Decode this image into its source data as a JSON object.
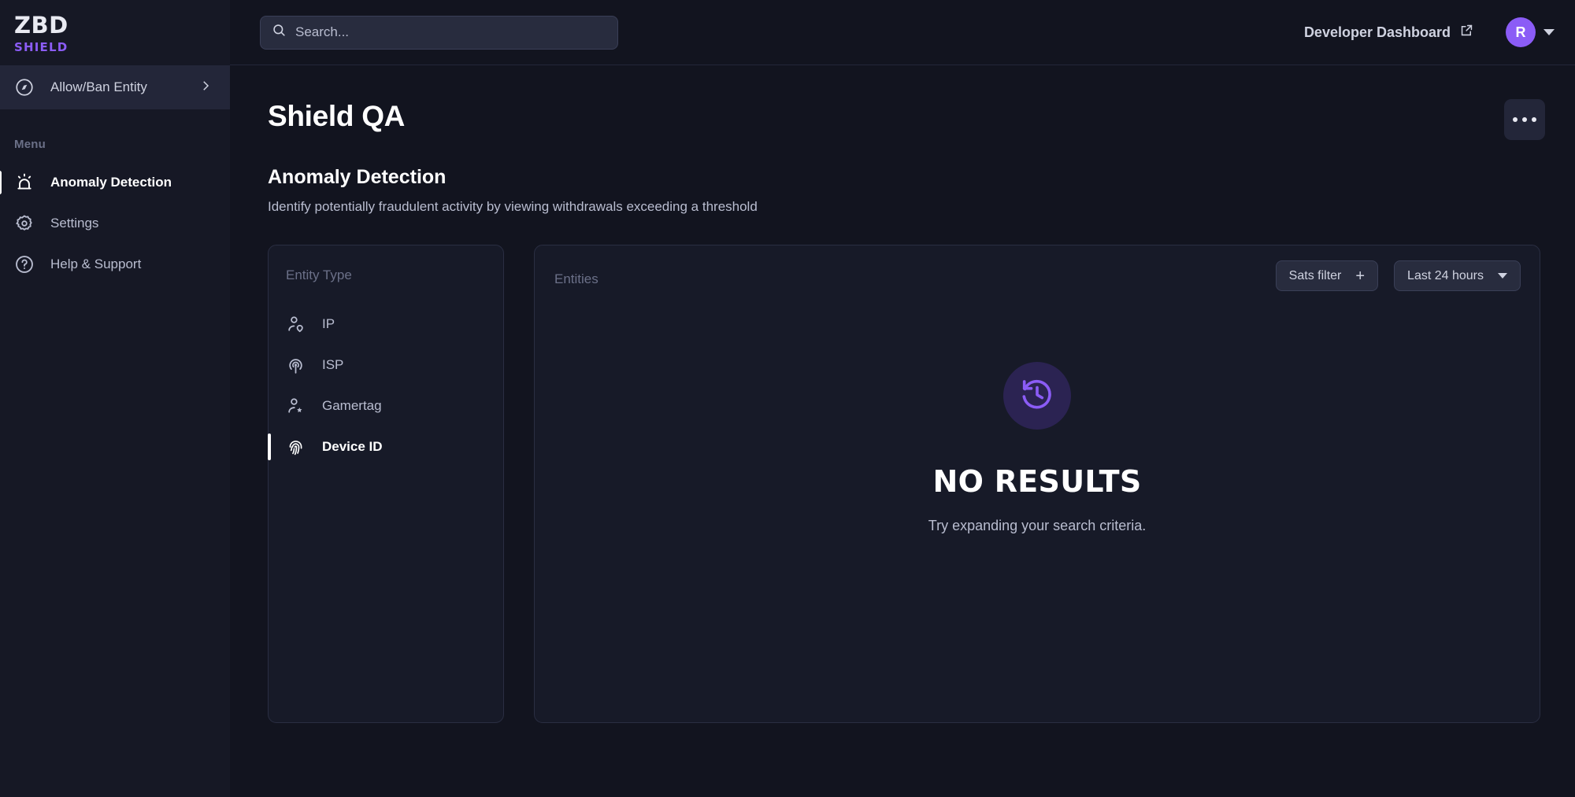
{
  "brand": {
    "line1": "ZBD",
    "line2": "SHIELD",
    "accent": "#8b5cf6"
  },
  "sidebar": {
    "allow_ban": {
      "label": "Allow/Ban Entity",
      "icon": "compass-icon",
      "chevron": "chevron-right-icon"
    },
    "menu_label": "Menu",
    "items": [
      {
        "label": "Anomaly Detection",
        "icon": "alarm-light-icon",
        "active": true
      },
      {
        "label": "Settings",
        "icon": "gear-icon",
        "active": false
      },
      {
        "label": "Help & Support",
        "icon": "question-circle-icon",
        "active": false
      }
    ]
  },
  "topbar": {
    "search": {
      "placeholder": "Search...",
      "value": "",
      "icon": "search-icon"
    },
    "developer_dashboard": {
      "label": "Developer Dashboard",
      "icon": "external-link-icon"
    },
    "avatar": {
      "initial": "R",
      "color": "#8b5cf6"
    },
    "caret": "chevron-down-icon"
  },
  "page": {
    "title": "Shield QA",
    "more_button": "ellipsis-icon",
    "section_title": "Anomaly Detection",
    "section_subtitle": "Identify potentially fraudulent activity by viewing withdrawals exceeding a threshold"
  },
  "entity_panel": {
    "header": "Entity Type",
    "items": [
      {
        "label": "IP",
        "icon": "user-location-icon",
        "active": false
      },
      {
        "label": "ISP",
        "icon": "signal-tower-icon",
        "active": false
      },
      {
        "label": "Gamertag",
        "icon": "user-star-icon",
        "active": false
      },
      {
        "label": "Device ID",
        "icon": "fingerprint-icon",
        "active": true
      }
    ]
  },
  "entities_panel": {
    "header": "Entities",
    "sats_filter": {
      "label": "Sats filter",
      "icon": "plus-icon"
    },
    "time_filter": {
      "label": "Last 24 hours",
      "icon": "chevron-down-icon"
    },
    "empty_state": {
      "icon": "history-clock-icon",
      "title": "NO RESULTS",
      "subtitle": "Try expanding your search criteria.",
      "icon_color": "#8b5cf6",
      "circle_color": "#2b2352"
    }
  }
}
